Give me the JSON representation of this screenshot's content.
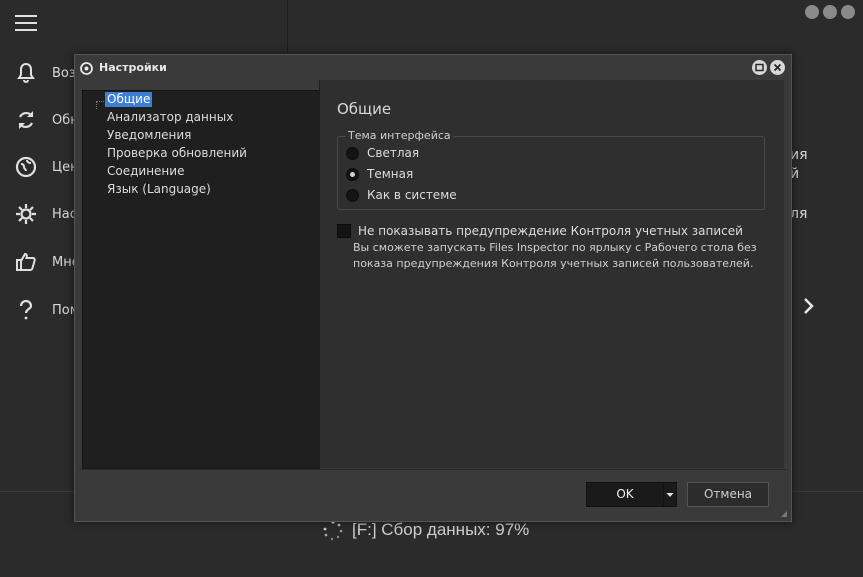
{
  "app": {
    "nav": [
      {
        "icon": "bell-icon",
        "label": "Возможности"
      },
      {
        "icon": "refresh-icon",
        "label": "Обновления"
      },
      {
        "icon": "globe-icon",
        "label": "Центр"
      },
      {
        "icon": "gear-icon",
        "label": "Настройки"
      },
      {
        "icon": "thumbs-up-icon",
        "label": "Мнение"
      },
      {
        "icon": "question-icon",
        "label": "Помощь"
      }
    ],
    "right_text": [
      "ия",
      "й",
      "ля"
    ],
    "status": "[F:] Сбор данных: 97%"
  },
  "dialog": {
    "title": "Настройки",
    "tree": [
      {
        "label": "Общие",
        "selected": true
      },
      {
        "label": "Анализатор данных",
        "selected": false
      },
      {
        "label": "Уведомления",
        "selected": false
      },
      {
        "label": "Проверка обновлений",
        "selected": false
      },
      {
        "label": "Соединение",
        "selected": false
      },
      {
        "label": "Язык (Language)",
        "selected": false
      }
    ],
    "section_title": "Общие",
    "theme_group": {
      "legend": "Тема интерфейса",
      "options": [
        {
          "label": "Светлая",
          "checked": false
        },
        {
          "label": "Темная",
          "checked": true
        },
        {
          "label": "Как в системе",
          "checked": false
        }
      ]
    },
    "uac_checkbox": {
      "label": "Не показывать предупреждение Контроля учетных записей",
      "checked": false,
      "hint_line1": "Вы сможете запускать Files Inspector по ярлыку с Рабочего стола без",
      "hint_line2": "показа предупреждения Контроля учетных записей пользователей."
    },
    "ok_label": "OK",
    "cancel_label": "Отмена"
  }
}
